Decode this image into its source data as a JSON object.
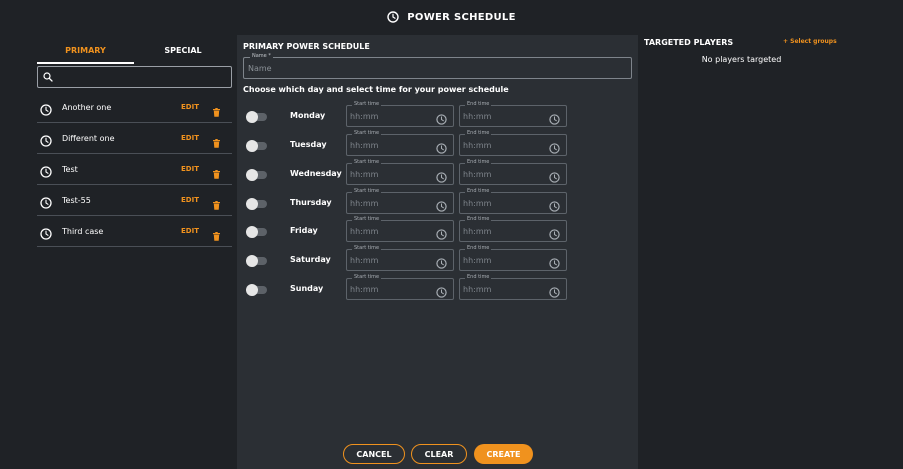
{
  "header": {
    "title": "POWER SCHEDULE",
    "icon": "clock-icon"
  },
  "tabs": {
    "primary": "PRIMARY",
    "special": "SPECIAL",
    "active": "primary"
  },
  "search": {
    "placeholder": ""
  },
  "schedules": [
    {
      "name": "Another one",
      "edit": "EDIT"
    },
    {
      "name": "Different one",
      "edit": "EDIT"
    },
    {
      "name": "Test",
      "edit": "EDIT"
    },
    {
      "name": "Test-55",
      "edit": "EDIT"
    },
    {
      "name": "Third case",
      "edit": "EDIT"
    }
  ],
  "form": {
    "title": "PRIMARY POWER SCHEDULE",
    "name_label": "Name *",
    "name_placeholder": "Name",
    "instruction": "Choose which day and select time for your power schedule",
    "start_label": "Start time",
    "end_label": "End time",
    "time_placeholder": "hh:mm",
    "days": [
      {
        "name": "Monday",
        "enabled": false
      },
      {
        "name": "Tuesday",
        "enabled": false
      },
      {
        "name": "Wednesday",
        "enabled": false
      },
      {
        "name": "Thursday",
        "enabled": false
      },
      {
        "name": "Friday",
        "enabled": false
      },
      {
        "name": "Saturday",
        "enabled": false
      },
      {
        "name": "Sunday",
        "enabled": false
      }
    ],
    "buttons": {
      "cancel": "CANCEL",
      "clear": "CLEAR",
      "create": "CREATE"
    }
  },
  "targeted": {
    "title": "TARGETED PLAYERS",
    "select_groups": "+ Select groups",
    "empty": "No players targeted"
  },
  "colors": {
    "accent": "#f0921e",
    "background": "#1f2226",
    "panel": "#2b2f34"
  }
}
